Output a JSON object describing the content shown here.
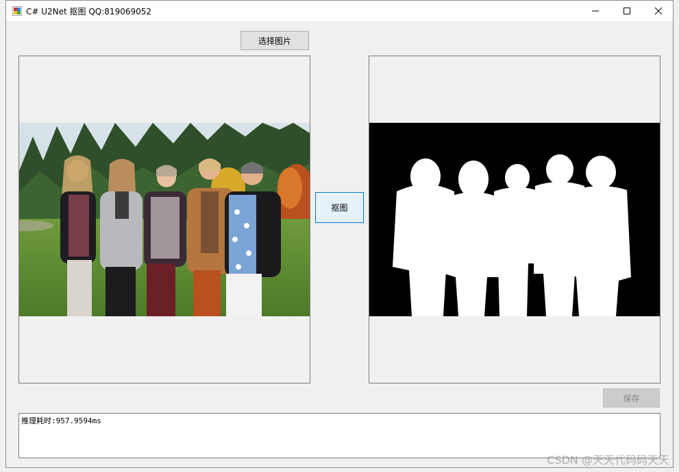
{
  "window": {
    "title": "C# U2Net 抠图 QQ:819069052",
    "controls": {
      "minimize_icon": "minimize-icon",
      "maximize_icon": "maximize-icon",
      "close_icon": "close-icon"
    }
  },
  "toolbar": {
    "select_image_label": "选择图片"
  },
  "actions": {
    "matting_label": "抠图",
    "save_label": "保存"
  },
  "panels": {
    "source": {
      "content": "photo of five women standing outdoors in front of trees"
    },
    "result": {
      "content": "white silhouette mask on black background"
    }
  },
  "output": {
    "text": "推理耗时:957.9594ms"
  },
  "watermark": "CSDN @天天代码码天天",
  "colors": {
    "accent_border": "#0078d7",
    "accent_fill": "#e5f1fb",
    "mask_bg": "#000000",
    "mask_fg": "#ffffff"
  }
}
